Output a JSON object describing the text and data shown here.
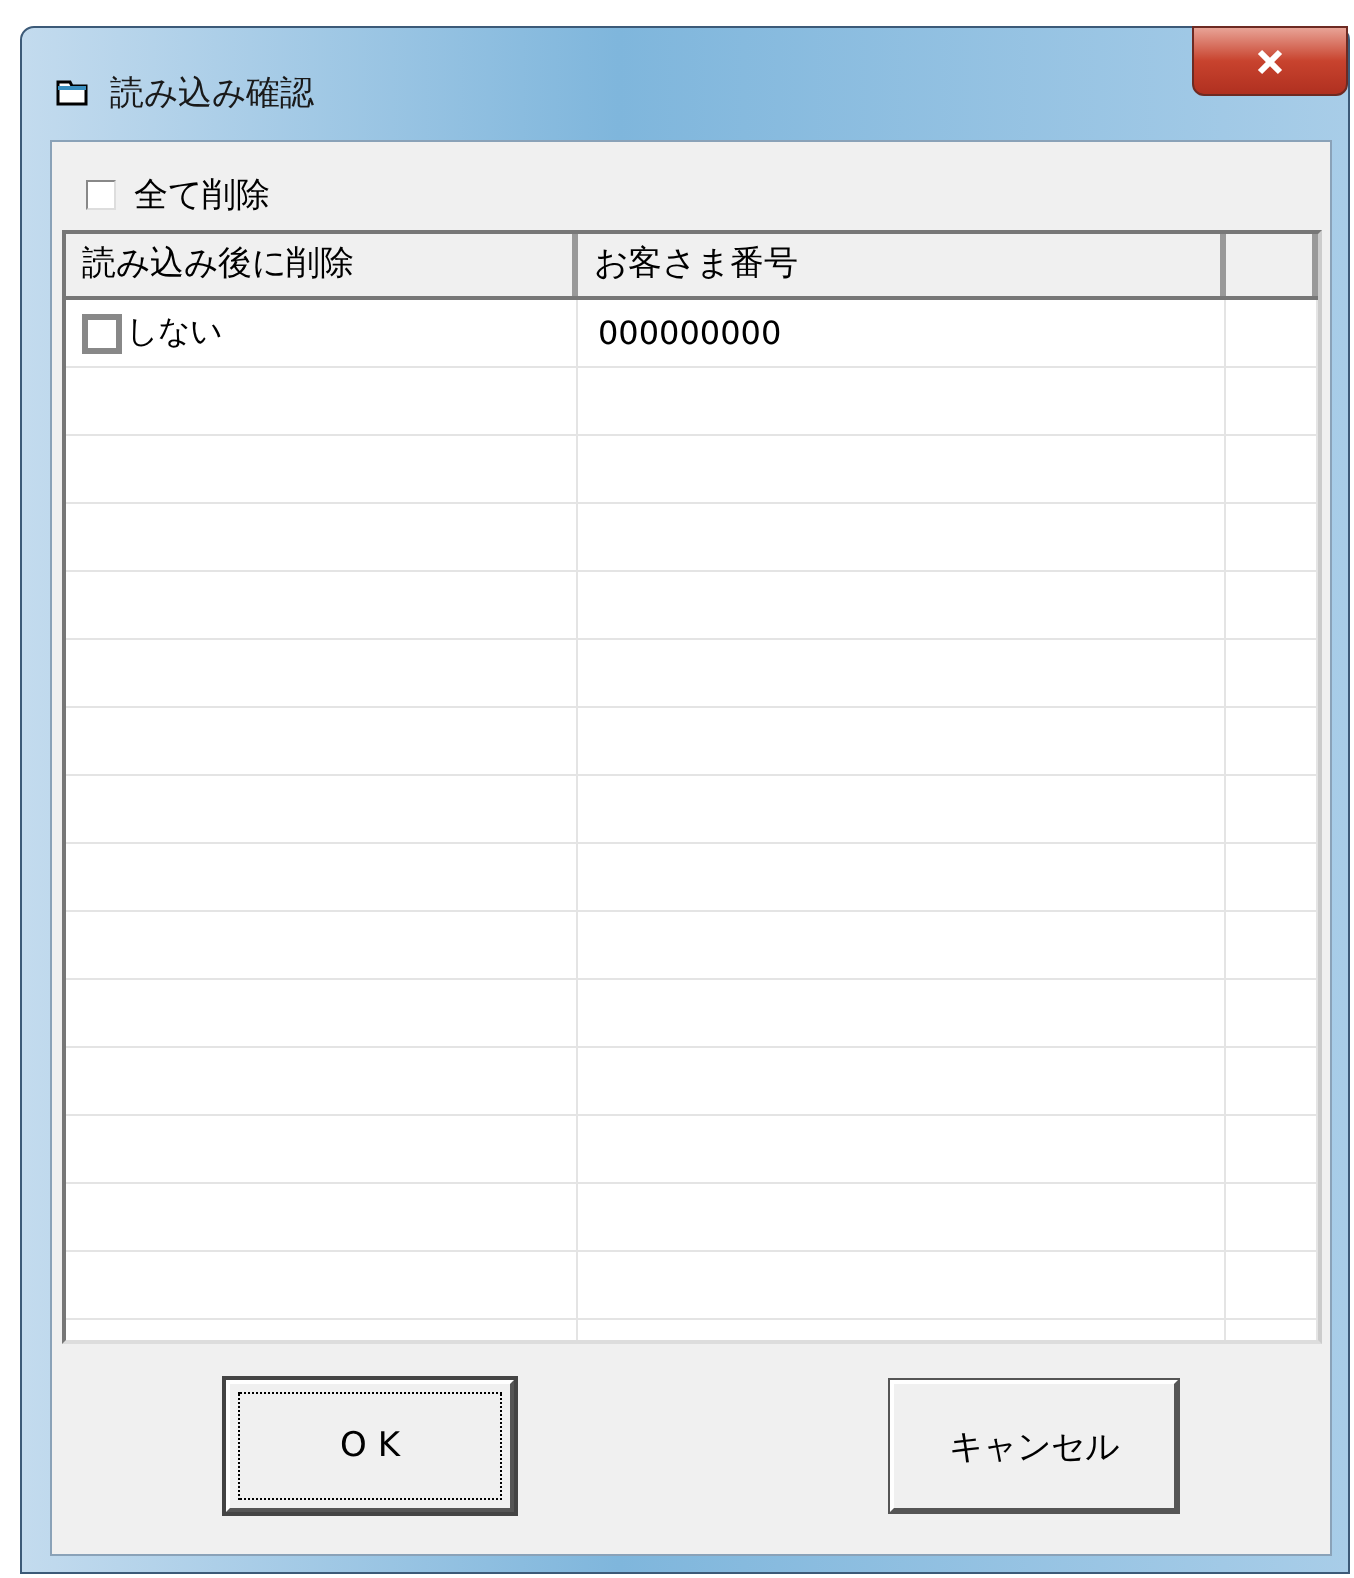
{
  "window": {
    "title": "読み込み確認"
  },
  "delete_all": {
    "label": "全て削除",
    "checked": false
  },
  "table": {
    "columns": [
      "読み込み後に削除",
      "お客さま番号"
    ],
    "rows": [
      {
        "delete": {
          "label": "しない",
          "checked": false
        },
        "customer_number": "000000000"
      }
    ]
  },
  "buttons": [
    {
      "label": "O K",
      "focused": true
    },
    {
      "label": "キャンセル",
      "focused": false
    }
  ]
}
